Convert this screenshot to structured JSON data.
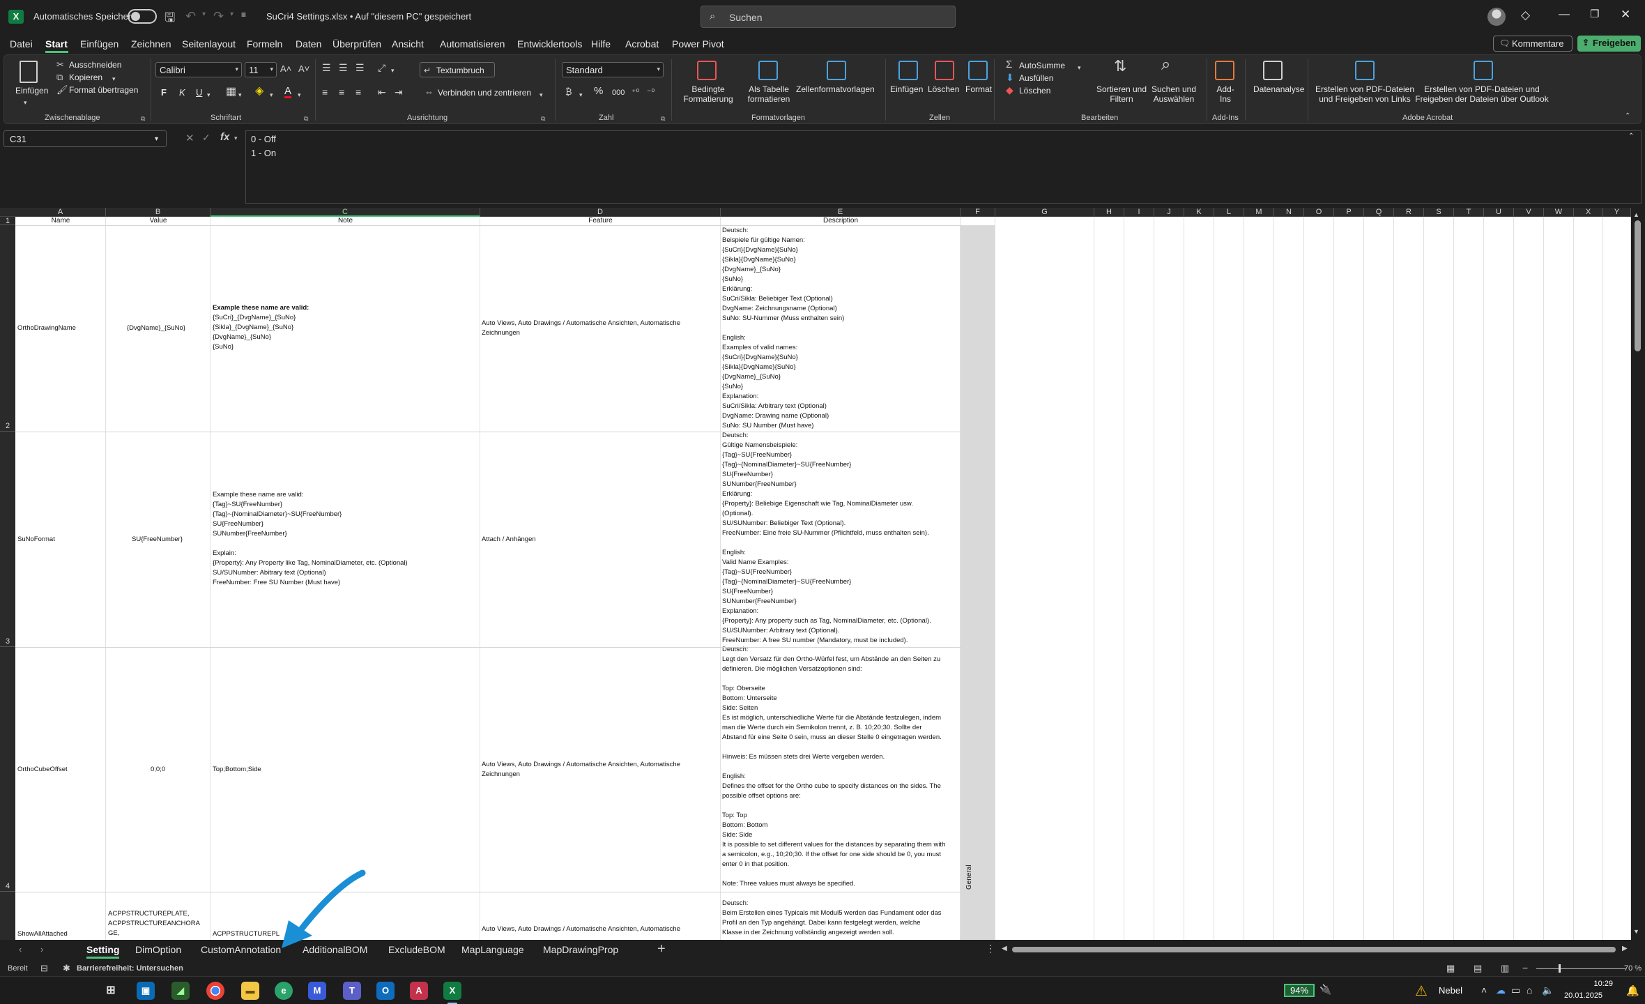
{
  "titlebar": {
    "autosave_label": "Automatisches Speichern",
    "doc_title": "SuCri4 Settings.xlsx • Auf \"diesem PC\" gespeichert",
    "search_placeholder": "Suchen"
  },
  "menu": [
    "Datei",
    "Start",
    "Einfügen",
    "Zeichnen",
    "Seitenlayout",
    "Formeln",
    "Daten",
    "Überprüfen",
    "Ansicht",
    "Automatisieren",
    "Entwicklertools",
    "Hilfe",
    "Acrobat",
    "Power Pivot"
  ],
  "menu_active": "Start",
  "comments_label": "Kommentare",
  "share_label": "Freigeben",
  "ribbon": {
    "clipboard": {
      "paste": "Einfügen",
      "cut": "Ausschneiden",
      "copy": "Kopieren",
      "format_painter": "Format übertragen",
      "label": "Zwischenablage"
    },
    "font": {
      "name": "Calibri",
      "size": "11",
      "bold": "F",
      "italic": "K",
      "underline": "U",
      "label": "Schriftart"
    },
    "alignment": {
      "wrap": "Textumbruch",
      "merge": "Verbinden und zentrieren",
      "label": "Ausrichtung"
    },
    "number": {
      "format": "Standard",
      "label": "Zahl"
    },
    "styles": {
      "conditional": "Bedingte Formatierung",
      "as_table": "Als Tabelle formatieren",
      "cell_styles": "Zellenformatvorlagen",
      "label": "Formatvorlagen"
    },
    "cells": {
      "insert": "Einfügen",
      "delete": "Löschen",
      "format": "Format",
      "label": "Zellen"
    },
    "editing": {
      "autosum": "AutoSumme",
      "fill": "Ausfüllen",
      "clear": "Löschen",
      "sort": "Sortieren und Filtern",
      "find": "Suchen und Auswählen",
      "label": "Bearbeiten"
    },
    "addins": {
      "addins": "Add-Ins",
      "label": "Add-Ins"
    },
    "analysis": {
      "label": "Datenanalyse"
    },
    "acrobat": {
      "pdf_links": "Erstellen von PDF-Dateien und Freigeben von Links",
      "pdf_outlook": "Erstellen von PDF-Dateien und Freigeben der Dateien über Outlook",
      "label": "Adobe Acrobat"
    }
  },
  "formula_bar": {
    "cell_ref": "C31",
    "line1": "0 - Off",
    "line2": "1 - On"
  },
  "columns": [
    "A",
    "B",
    "C",
    "D",
    "E",
    "F",
    "G",
    "H",
    "I",
    "J",
    "K",
    "L",
    "M",
    "N",
    "O",
    "P",
    "Q",
    "R",
    "S",
    "T",
    "U",
    "V",
    "W",
    "X",
    "Y"
  ],
  "rows": [
    "1",
    "2",
    "3",
    "4"
  ],
  "header_row": {
    "name": "Name",
    "value": "Value",
    "note": "Note",
    "feature": "Feature",
    "description": "Description"
  },
  "general_label": "General",
  "cells": {
    "r2": {
      "name": "OrthoDrawingName",
      "value": "{DvgName}_{SuNo}",
      "note_bold": "Example these name are valid:",
      "note": "{SuCri}_{DvgName}_{SuNo}\n{Sikla}_{DvgName}_{SuNo}\n{DvgName}_{SuNo}\n{SuNo}",
      "feature": "Auto Views, Auto Drawings / Automatische Ansichten, Automatische\nZeichnungen",
      "description": "Deutsch:\nBeispiele für gültige Namen:\n{SuCri}{DvgName}{SuNo}\n{Sikla}{DvgName}{SuNo}\n{DvgName}_{SuNo}\n{SuNo}\nErklärung:\nSuCri/Sikla: Beliebiger Text (Optional)\nDvgName: Zeichnungsname (Optional)\nSuNo: SU-Nummer (Muss enthalten sein)\n\nEnglish:\nExamples of valid names:\n{SuCri}{DvgName}{SuNo}\n{Sikla}{DvgName}{SuNo}\n{DvgName}_{SuNo}\n{SuNo}\nExplanation:\nSuCri/Sikla: Arbitrary text (Optional)\nDvgName: Drawing name (Optional)\nSuNo: SU Number (Must have)"
    },
    "r3": {
      "name": "SuNoFormat",
      "value": "SU{FreeNumber}",
      "note": "Example these name are valid:\n{Tag}~SU{FreeNumber}\n{Tag}~{NominalDiameter}~SU{FreeNumber}\nSU{FreeNumber}\nSUNumber{FreeNumber}\n\nExplain:\n{Property}: Any Property like Tag, NominalDiameter, etc. (Optional)\nSU/SUNumber: Abitrary text (Optional)\nFreeNumber: Free SU Number (Must have)",
      "feature": "Attach / Anhängen",
      "description": "Deutsch:\nGültige Namensbeispiele:\n{Tag}~SU{FreeNumber}\n{Tag}~{NominalDiameter}~SU{FreeNumber}\nSU{FreeNumber}\nSUNumber{FreeNumber}\nErklärung:\n{Property}: Beliebige Eigenschaft wie Tag, NominalDiameter usw.\n(Optional).\nSU/SUNumber: Beliebiger Text (Optional).\nFreeNumber: Eine freie SU-Nummer (Pflichtfeld, muss enthalten sein).\n\nEnglish:\nValid Name Examples:\n{Tag}~SU{FreeNumber}\n{Tag}~{NominalDiameter}~SU{FreeNumber}\nSU{FreeNumber}\nSUNumber{FreeNumber}\nExplanation:\n{Property}: Any property such as Tag, NominalDiameter, etc. (Optional).\nSU/SUNumber: Arbitrary text (Optional).\nFreeNumber: A free SU number (Mandatory, must be included)."
    },
    "r4": {
      "name": "OrthoCubeOffset",
      "value": "0;0;0",
      "note": "Top;Bottom;Side",
      "feature": "Auto Views, Auto Drawings / Automatische Ansichten, Automatische\nZeichnungen",
      "description": "Deutsch:\nLegt den Versatz für den Ortho-Würfel fest, um Abstände an den Seiten zu\ndefinieren. Die möglichen Versatzoptionen sind:\n\nTop: Oberseite\nBottom: Unterseite\nSide: Seiten\nEs ist möglich, unterschiedliche Werte für die Abstände festzulegen, indem\nman die Werte durch ein Semikolon trennt, z. B. 10;20;30. Sollte der\nAbstand für eine Seite 0 sein, muss an dieser Stelle 0 eingetragen werden.\n\nHinweis: Es müssen stets drei Werte vergeben werden.\n\nEnglish:\nDefines the offset for the Ortho cube to specify distances on the sides. The\npossible offset options are:\n\nTop: Top\nBottom: Bottom\nSide: Side\nIt is possible to set different values for the distances by separating them with\na semicolon, e.g., 10;20;30. If the offset for one side should be 0, you must\nenter 0 in that position.\n\nNote: Three values must always be specified."
    },
    "r5": {
      "name": "ShowAllAttached",
      "value": "ACPPSTRUCTUREPLATE,\nACPPSTRUCTUREANCHORA\nGE,",
      "note": "ACPPSTRUCTUREPL",
      "feature": "Auto Views, Auto Drawings / Automatische Ansichten, Automatische",
      "description": "Deutsch:\nBeim Erstellen eines Typicals mit Modul5 werden das Fundament oder das\nProfil an den Typ angehängt. Dabei kann festgelegt werden, welche\nKlasse in der Zeichnung vollständig angezeigt werden soll."
    }
  },
  "sheets": [
    "Setting",
    "DimOption",
    "CustomAnnotation",
    "AdditionalBOM",
    "ExcludeBOM",
    "MapLanguage",
    "MapDrawingProp"
  ],
  "active_sheet": "Setting",
  "status": {
    "ready": "Bereit",
    "accessibility": "Barrierefreiheit: Untersuchen",
    "zoom": "70 %"
  },
  "taskbar": {
    "battery": "94%",
    "weather": "Nebel",
    "time": "10:29",
    "date": "20.01.2025"
  },
  "colors": {
    "accent": "#4cc27a",
    "excel": "#107c41",
    "share": "#4cae6e",
    "arrow": "#1a8fd6"
  }
}
